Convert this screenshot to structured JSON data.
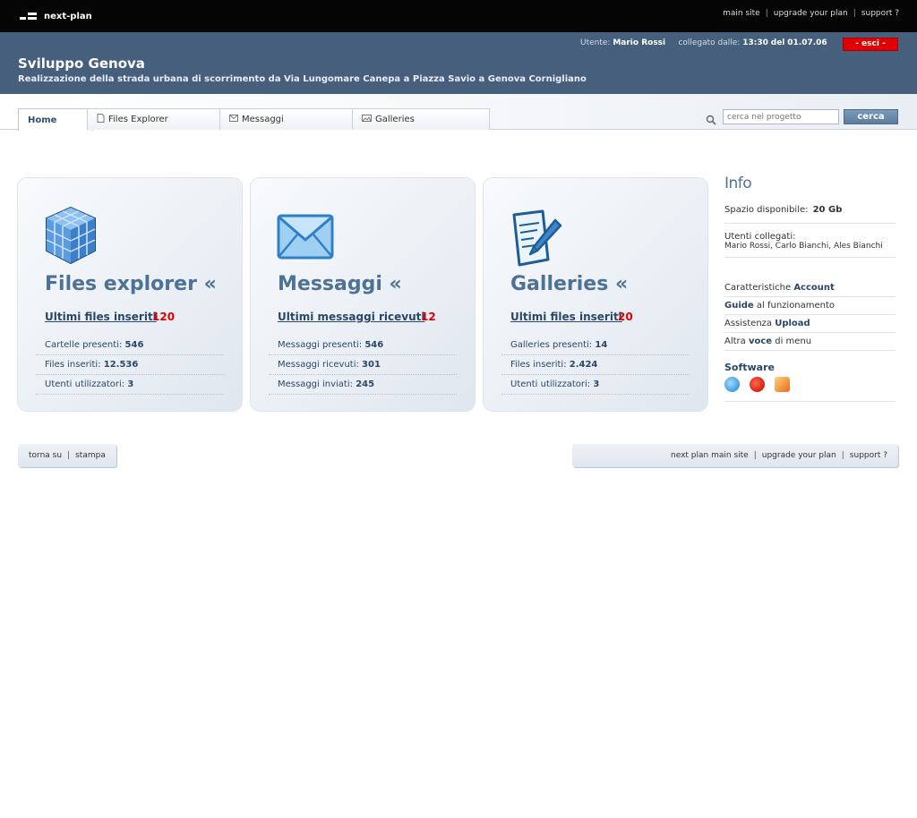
{
  "topbar": {
    "logo_text": "next-plan",
    "links": [
      "main site",
      "upgrade your plan",
      "support ?"
    ]
  },
  "header": {
    "user_label": "Utente:",
    "user_name": "Mario Rossi",
    "connected_label": "collegato dalle:",
    "connected_time": "13:30",
    "connected_of": "del",
    "connected_date": "01.07.06",
    "logout_label": "- esci -",
    "project_title": "Sviluppo Genova",
    "project_subtitle": "Realizzazione della strada urbana di scorrimento da Via Lungomare Canepa a Piazza Savio a Genova Cornigliano"
  },
  "tabs": [
    {
      "label": "Home",
      "active": true
    },
    {
      "label": "Files Explorer",
      "icon": "file-icon"
    },
    {
      "label": "Messaggi",
      "icon": "envelope-icon"
    },
    {
      "label": "Galleries",
      "icon": "image-icon"
    }
  ],
  "search": {
    "placeholder": "cerca nel progetto",
    "button_label": "cerca"
  },
  "cards": [
    {
      "icon": "cube-icon",
      "title": "Files explorer «",
      "link_label": "Ultimi files inseriti",
      "link_count": "120",
      "rows": [
        {
          "label": "Cartelle presenti:",
          "value": "546"
        },
        {
          "label": "Files inseriti:",
          "value": "12.536"
        },
        {
          "label": "Utenti utilizzatori:",
          "value": "3"
        }
      ]
    },
    {
      "icon": "envelope-icon",
      "title": "Messaggi «",
      "link_label": "Ultimi messaggi ricevuti",
      "link_count": "12",
      "rows": [
        {
          "label": "Messaggi presenti:",
          "value": "546"
        },
        {
          "label": "Messaggi ricevuti:",
          "value": "301"
        },
        {
          "label": "Messaggi inviati:",
          "value": "245"
        }
      ]
    },
    {
      "icon": "document-pen-icon",
      "title": "Galleries «",
      "link_label": "Ultimi files inseriti",
      "link_count": "20",
      "rows": [
        {
          "label": "Galleries presenti:",
          "value": "14"
        },
        {
          "label": "Files inseriti:",
          "value": "2.424"
        },
        {
          "label": "Utenti utilizzatori:",
          "value": "3"
        }
      ]
    }
  ],
  "info": {
    "title": "Info",
    "space_label": "Spazio disponibile:",
    "space_value": "20 Gb",
    "users_label": "Utenti collegati:",
    "users_list": "Mario Rossi, Carlo Bianchi, Ales Bianchi",
    "menu": [
      {
        "pre": "Caratteristiche ",
        "bold": "Account",
        "post": ""
      },
      {
        "pre": "",
        "bold": "Guide",
        "post": " al funzionamento"
      },
      {
        "pre": "Assistenza ",
        "bold": "Upload",
        "post": ""
      },
      {
        "pre": "Altra ",
        "bold": "voce",
        "post": " di menu"
      }
    ],
    "software_title": "Software",
    "software_icons": [
      "internet-explorer-icon",
      "flash-player-icon",
      "firefox-icon"
    ]
  },
  "footer": {
    "left_links": [
      "torna su",
      "stampa"
    ],
    "right_links": [
      "next plan main site",
      "upgrade your plan",
      "support ?"
    ]
  },
  "colors": {
    "header_bg": "#455f7c",
    "accent_blue": "#4e7296",
    "alert_red": "#e10000"
  }
}
